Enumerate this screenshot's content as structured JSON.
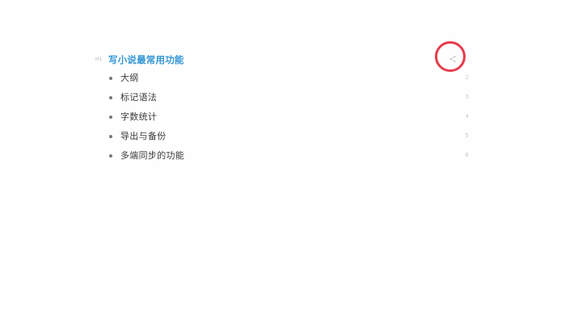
{
  "editor": {
    "heading": {
      "tag": "H1",
      "text": "写小说最常用功能"
    },
    "share_icon": "share-icon",
    "highlight_color": "#e53a4a",
    "items": [
      {
        "text": "大纲",
        "line": "2"
      },
      {
        "text": "标记语法",
        "line": "3"
      },
      {
        "text": "字数统计",
        "line": "4"
      },
      {
        "text": "导出与备份",
        "line": "5"
      },
      {
        "text": "多端同步的功能",
        "line": "6"
      }
    ]
  },
  "colors": {
    "heading": "#3396d6",
    "text": "#3a3a3a",
    "muted": "#c7c7c7",
    "background": "#fefefe"
  }
}
